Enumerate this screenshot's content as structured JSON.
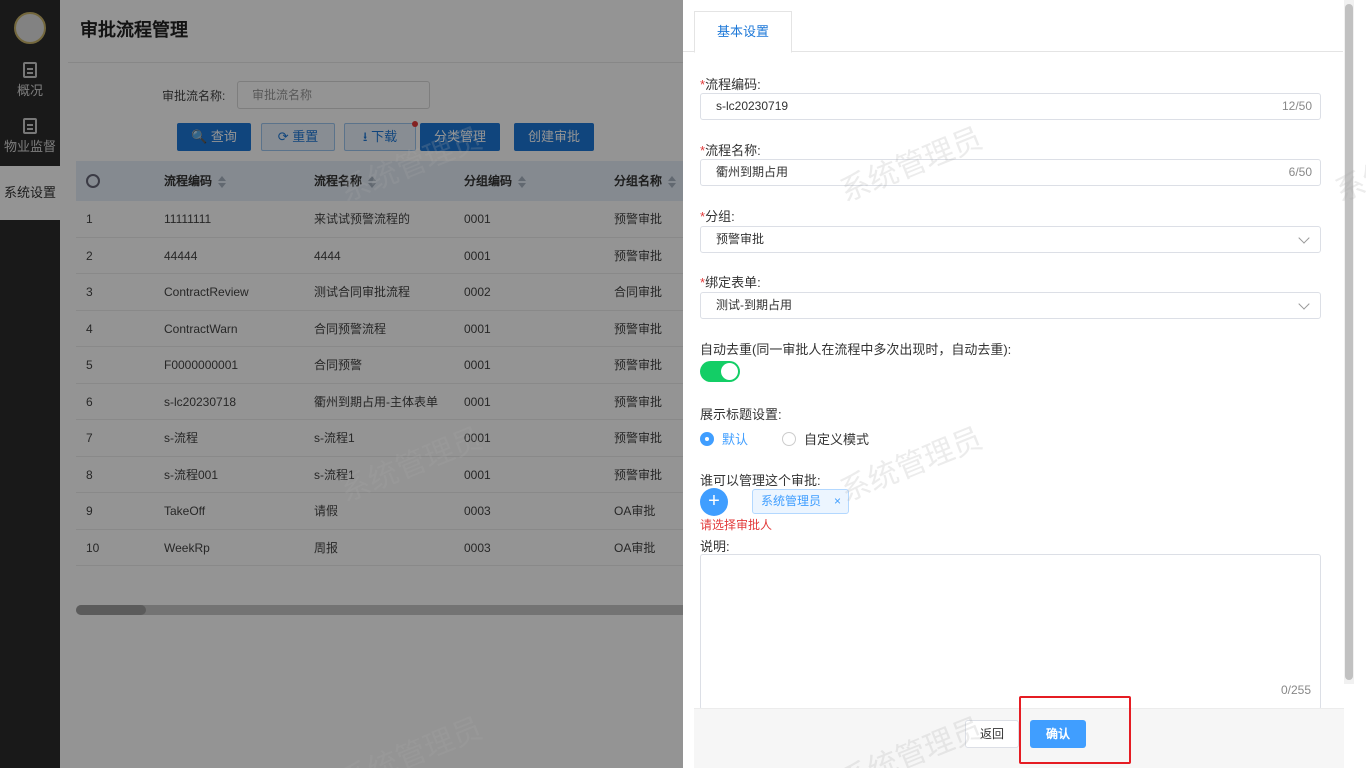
{
  "nav": {
    "items": [
      {
        "label": "概况"
      },
      {
        "label": "物业监督"
      },
      {
        "label": "系统设置"
      }
    ]
  },
  "page": {
    "title": "审批流程管理",
    "search_label": "审批流名称:",
    "search_placeholder": "审批流名称",
    "buttons": {
      "query": "查询",
      "reset": "重置",
      "download": "下载",
      "category": "分类管理",
      "create": "创建审批"
    }
  },
  "table": {
    "columns": [
      "流程编码",
      "流程名称",
      "分组编码",
      "分组名称"
    ],
    "rows": [
      {
        "idx": "1",
        "code": "11111111",
        "name": "来试试预警流程的",
        "group_code": "0001",
        "group_name": "预警审批"
      },
      {
        "idx": "2",
        "code": "44444",
        "name": "4444",
        "group_code": "0001",
        "group_name": "预警审批"
      },
      {
        "idx": "3",
        "code": "ContractReview",
        "name": "测试合同审批流程",
        "group_code": "0002",
        "group_name": "合同审批"
      },
      {
        "idx": "4",
        "code": "ContractWarn",
        "name": "合同预警流程",
        "group_code": "0001",
        "group_name": "预警审批"
      },
      {
        "idx": "5",
        "code": "F0000000001",
        "name": "合同预警",
        "group_code": "0001",
        "group_name": "预警审批"
      },
      {
        "idx": "6",
        "code": "s-lc20230718",
        "name": "衢州到期占用-主体表单",
        "group_code": "0001",
        "group_name": "预警审批"
      },
      {
        "idx": "7",
        "code": "s-流程",
        "name": "s-流程1",
        "group_code": "0001",
        "group_name": "预警审批"
      },
      {
        "idx": "8",
        "code": "s-流程001",
        "name": "s-流程1",
        "group_code": "0001",
        "group_name": "预警审批"
      },
      {
        "idx": "9",
        "code": "TakeOff",
        "name": "请假",
        "group_code": "0003",
        "group_name": "OA审批"
      },
      {
        "idx": "10",
        "code": "WeekRp",
        "name": "周报",
        "group_code": "0003",
        "group_name": "OA审批"
      }
    ]
  },
  "drawer": {
    "tab": "基本设置",
    "process_code": {
      "label": "流程编码:",
      "value": "s-lc20230719",
      "counter": "12/50"
    },
    "process_name": {
      "label": "流程名称:",
      "value": "衢州到期占用",
      "counter": "6/50"
    },
    "group": {
      "label": "分组:",
      "value": "预警审批"
    },
    "form": {
      "label": "绑定表单:",
      "value": "测试-到期占用"
    },
    "dedupe": {
      "label": "自动去重(同一审批人在流程中多次出现时，自动去重):",
      "enabled": true
    },
    "title_setting": {
      "label": "展示标题设置:",
      "options": [
        "默认",
        "自定义模式"
      ],
      "selected": "默认"
    },
    "managers": {
      "label": "谁可以管理这个审批:",
      "tags": [
        "系统管理员"
      ],
      "error": "请选择审批人",
      "add_icon": "plus-icon"
    },
    "description": {
      "label": "说明:",
      "value": "",
      "counter": "0/255"
    },
    "footer": {
      "back": "返回",
      "confirm": "确认"
    }
  },
  "watermark": "系统管理员",
  "colors": {
    "primary": "#409eff",
    "nav_bg": "#2b2b2b",
    "toggle_on": "#13ce66",
    "error": "#e23a3a",
    "highlight": "#e51c23"
  }
}
